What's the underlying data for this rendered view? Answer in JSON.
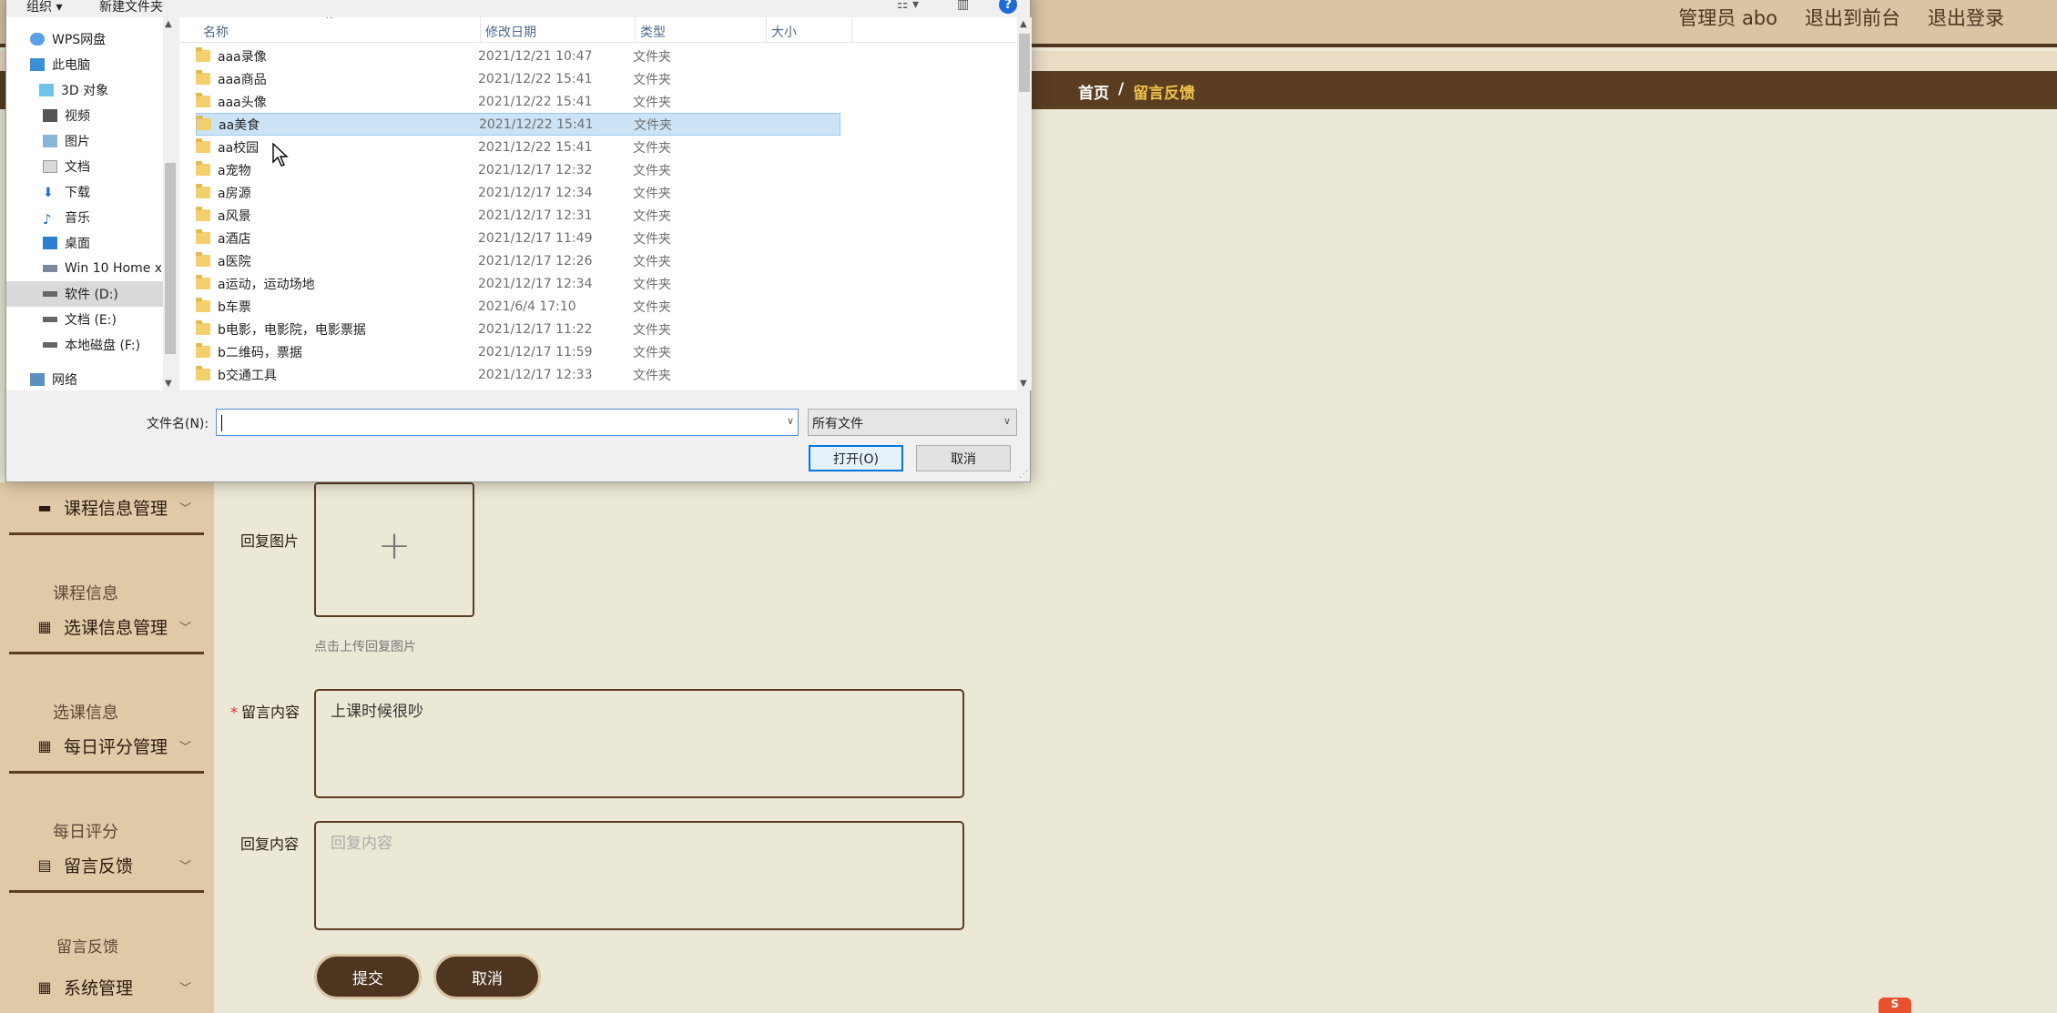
{
  "header": {
    "links": [
      "管理员 abo",
      "退出到前台",
      "退出登录"
    ]
  },
  "breadcrumb": {
    "home": "首页",
    "separator": "/",
    "current": "留言反馈"
  },
  "sidebar": {
    "groups": [
      {
        "label": "课程信息管理",
        "icon": "book-icon",
        "item": "课程信息"
      },
      {
        "label": "选课信息管理",
        "icon": "grid-icon",
        "item": "选课信息"
      },
      {
        "label": "每日评分管理",
        "icon": "grid-icon",
        "item": "每日评分"
      },
      {
        "label": "留言反馈",
        "icon": "clipboard-icon",
        "item": "留言反馈"
      },
      {
        "label": "系统管理",
        "icon": "grid-icon",
        "item": ""
      }
    ]
  },
  "form": {
    "reply_image_label": "回复图片",
    "upload_hint": "点击上传回复图片",
    "message_label": "留言内容",
    "message_value": "上课时候很吵",
    "reply_label": "回复内容",
    "reply_placeholder": "回复内容",
    "submit": "提交",
    "cancel": "取消"
  },
  "dialog": {
    "toolbar": {
      "organize": "组织 ▾",
      "new_folder": "新建文件夹"
    },
    "nav_items": [
      {
        "label": "WPS网盘",
        "icon": "cloud-icon"
      },
      {
        "label": "此电脑",
        "icon": "computer-icon"
      },
      {
        "label": "3D 对象",
        "icon": "cube-icon"
      },
      {
        "label": "视频",
        "icon": "video-icon"
      },
      {
        "label": "图片",
        "icon": "picture-icon"
      },
      {
        "label": "文档",
        "icon": "document-icon"
      },
      {
        "label": "下载",
        "icon": "download-icon"
      },
      {
        "label": "音乐",
        "icon": "music-icon"
      },
      {
        "label": "桌面",
        "icon": "desktop-icon"
      },
      {
        "label": "Win 10 Home x",
        "icon": "drive-icon"
      },
      {
        "label": "软件 (D:)",
        "icon": "drive-icon"
      },
      {
        "label": "文档 (E:)",
        "icon": "drive-icon"
      },
      {
        "label": "本地磁盘 (F:)",
        "icon": "drive-icon"
      },
      {
        "label": "网络",
        "icon": "network-icon"
      }
    ],
    "columns": [
      "名称",
      "修改日期",
      "类型",
      "大小"
    ],
    "files": [
      {
        "name": "aaa录像",
        "date": "2021/12/21 10:47",
        "type": "文件夹"
      },
      {
        "name": "aaa商品",
        "date": "2021/12/22 15:41",
        "type": "文件夹"
      },
      {
        "name": "aaa头像",
        "date": "2021/12/22 15:41",
        "type": "文件夹"
      },
      {
        "name": "aa美食",
        "date": "2021/12/22 15:41",
        "type": "文件夹"
      },
      {
        "name": "aa校园",
        "date": "2021/12/22 15:41",
        "type": "文件夹"
      },
      {
        "name": "a宠物",
        "date": "2021/12/17 12:32",
        "type": "文件夹"
      },
      {
        "name": "a房源",
        "date": "2021/12/17 12:34",
        "type": "文件夹"
      },
      {
        "name": "a风景",
        "date": "2021/12/17 12:31",
        "type": "文件夹"
      },
      {
        "name": "a酒店",
        "date": "2021/12/17 11:49",
        "type": "文件夹"
      },
      {
        "name": "a医院",
        "date": "2021/12/17 12:26",
        "type": "文件夹"
      },
      {
        "name": "a运动，运动场地",
        "date": "2021/12/17 12:34",
        "type": "文件夹"
      },
      {
        "name": "b车票",
        "date": "2021/6/4 17:10",
        "type": "文件夹"
      },
      {
        "name": "b电影，电影院，电影票据",
        "date": "2021/12/17 11:22",
        "type": "文件夹"
      },
      {
        "name": "b二维码，票据",
        "date": "2021/12/17 11:59",
        "type": "文件夹"
      },
      {
        "name": "b交通工具",
        "date": "2021/12/17 12:33",
        "type": "文件夹"
      }
    ],
    "filename_label": "文件名(N):",
    "filename_value": "",
    "filter_value": "所有文件",
    "open": "打开(O)",
    "cancel": "取消"
  },
  "colors": {
    "brand_dark": "#4e3520",
    "accent_yellow": "#f0c24a",
    "selection": "#cce3f6"
  }
}
